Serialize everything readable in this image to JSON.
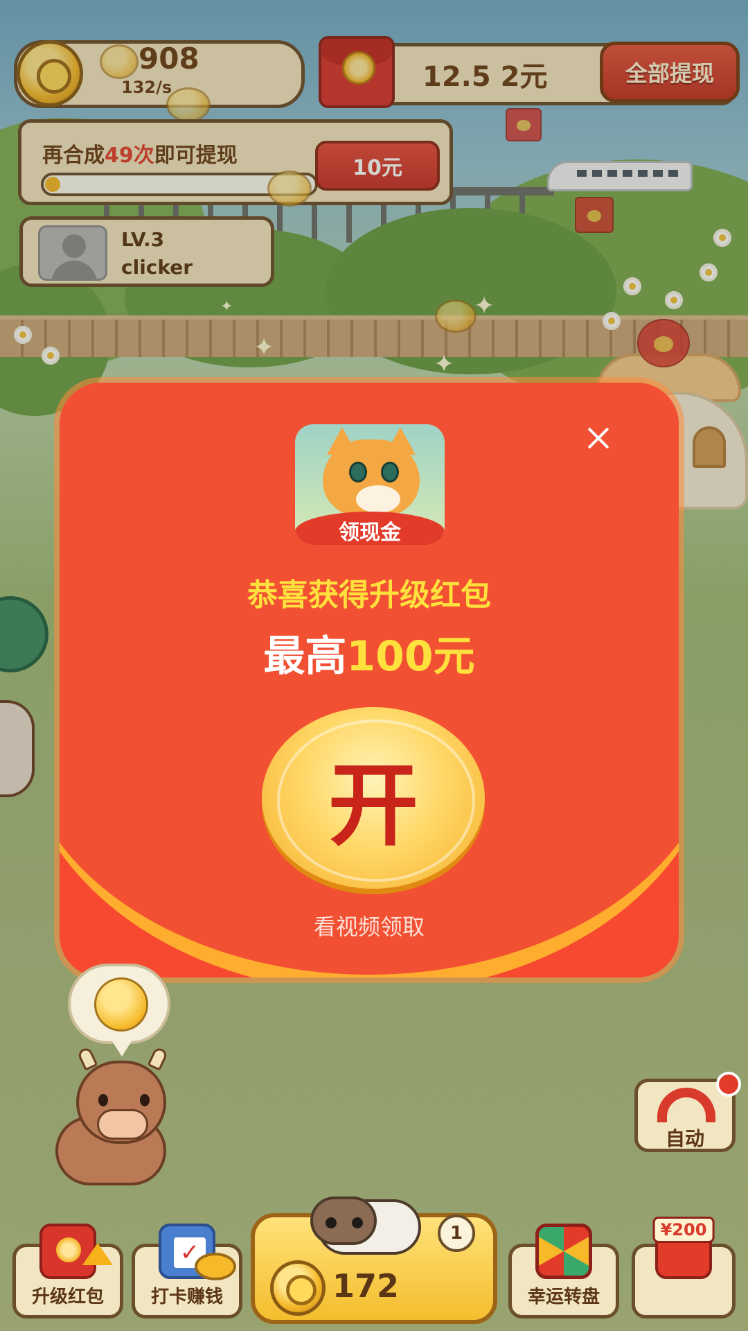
{
  "hud": {
    "coins_value": "908",
    "coins_rate": "132/s",
    "cash_value": "12.5 2元",
    "withdraw_all_label": "全部提现"
  },
  "merge_task": {
    "prefix": "再合成",
    "count": "49次",
    "suffix": "即可提现",
    "progress": 0.02,
    "reward_label": "10元"
  },
  "user": {
    "level": "LV.3",
    "name": "clicker"
  },
  "modal": {
    "app_badge": "领现金",
    "title": "恭喜获得升级红包",
    "subtitle_prefix": "最高",
    "subtitle_amount": "100元",
    "open_label": "开",
    "footer": "看视频领取"
  },
  "side": {
    "auto_label": "自动"
  },
  "bottom_bar": {
    "upgrade_rp_label": "升级红包",
    "checkin_label": "打卡赚钱",
    "merge_value": "172",
    "cat_level": "1",
    "wheel_label": "幸运转盘",
    "gift_tag": "¥200"
  },
  "colors": {
    "envelope_red": "#f7492f",
    "gold": "#ffe13d",
    "hud_brown": "#6b4e2b"
  },
  "icons": [
    "coin-icon",
    "red-packet-icon",
    "close-icon",
    "magnet-icon",
    "calendar-icon",
    "wheel-icon",
    "gift-icon"
  ]
}
